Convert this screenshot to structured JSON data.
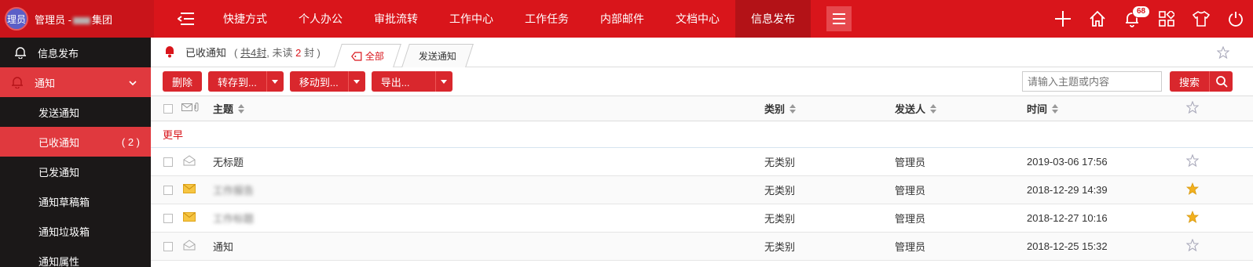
{
  "brand": {
    "avatar_text": "理员",
    "user_prefix": "管理员 -",
    "user_suffix": "集团"
  },
  "nav": [
    "快捷方式",
    "个人办公",
    "审批流转",
    "工作中心",
    "工作任务",
    "内部邮件",
    "文档中心",
    "信息发布"
  ],
  "nav_active": "信息发布",
  "notifications_count": "68",
  "sidebar": {
    "root": "信息发布",
    "group": "通知",
    "items": [
      {
        "label": "发送通知",
        "count": ""
      },
      {
        "label": "已收通知",
        "count": "( 2 )"
      },
      {
        "label": "已发通知",
        "count": ""
      },
      {
        "label": "通知草稿箱",
        "count": ""
      },
      {
        "label": "通知垃圾箱",
        "count": ""
      },
      {
        "label": "通知属性",
        "count": ""
      }
    ]
  },
  "header": {
    "title": "已收通知",
    "count_open": "(",
    "total": "共4封",
    "unread_prefix": ", 未读",
    "unread_num": "2",
    "unread_suffix": "封 )",
    "tabs": [
      "全部",
      "发送通知"
    ]
  },
  "toolbar": {
    "delete": "删除",
    "save_to": "转存到...",
    "move_to": "移动到...",
    "export": "导出...",
    "search_placeholder": "请输入主题或内容",
    "search": "搜索"
  },
  "table": {
    "headers": {
      "subject": "主题",
      "category": "类别",
      "sender": "发送人",
      "time": "时间"
    },
    "group_label": "更早",
    "rows": [
      {
        "subject": "无标题",
        "category": "无类别",
        "sender": "管理员",
        "time": "2019-03-06 17:56",
        "read": true,
        "starred": false
      },
      {
        "subject": "工作报告",
        "category": "无类别",
        "sender": "管理员",
        "time": "2018-12-29 14:39",
        "read": false,
        "starred": true
      },
      {
        "subject": "工作标题",
        "category": "无类别",
        "sender": "管理员",
        "time": "2018-12-27 10:16",
        "read": false,
        "starred": true
      },
      {
        "subject": "通知",
        "category": "无类别",
        "sender": "管理员",
        "time": "2018-12-25 15:32",
        "read": true,
        "starred": false
      }
    ]
  },
  "colors": {
    "primary": "#d9151b",
    "sidebar_bg": "#1b1818",
    "sidebar_active": "#e0393e",
    "star_gold": "#f2b01e"
  }
}
